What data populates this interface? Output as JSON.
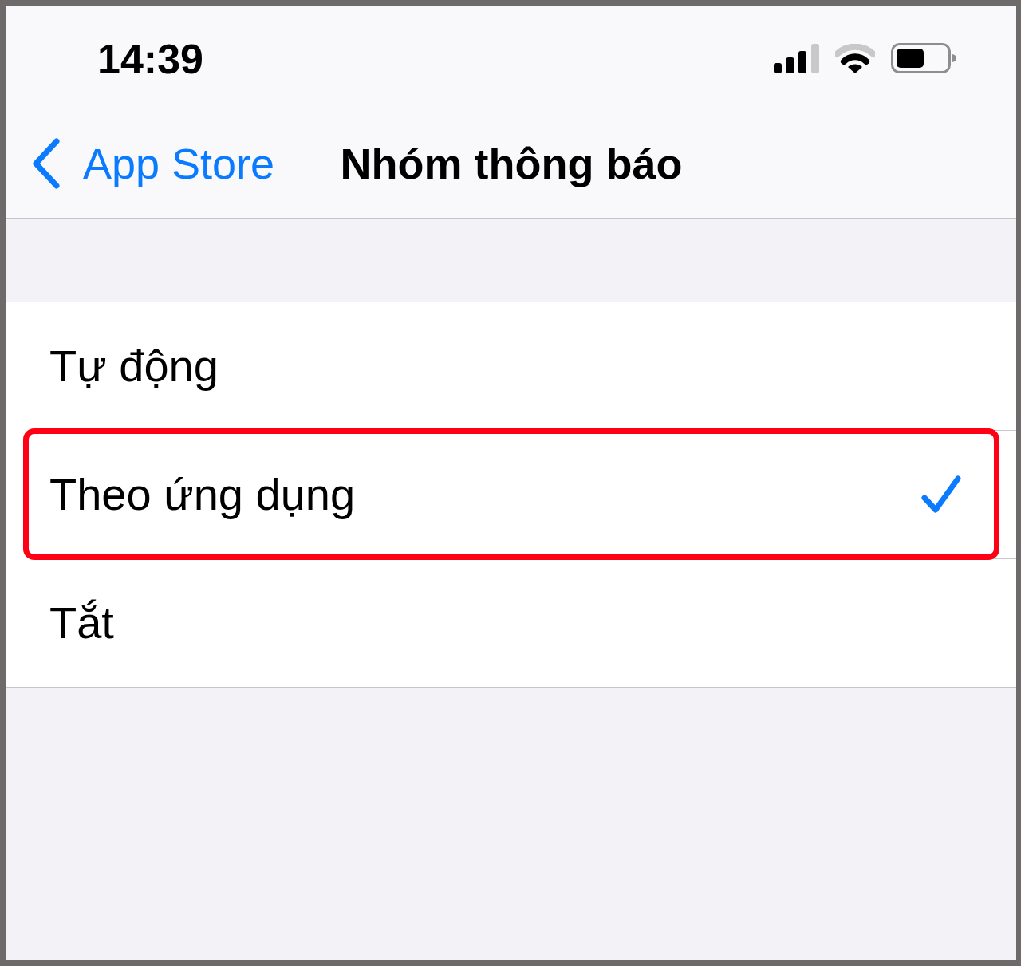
{
  "status_bar": {
    "time": "14:39"
  },
  "nav_bar": {
    "back_label": "App Store",
    "title": "Nhóm thông báo"
  },
  "options": [
    {
      "label": "Tự động",
      "selected": false,
      "highlighted": false
    },
    {
      "label": "Theo ứng dụng",
      "selected": true,
      "highlighted": true
    },
    {
      "label": "Tắt",
      "selected": false,
      "highlighted": false
    }
  ]
}
